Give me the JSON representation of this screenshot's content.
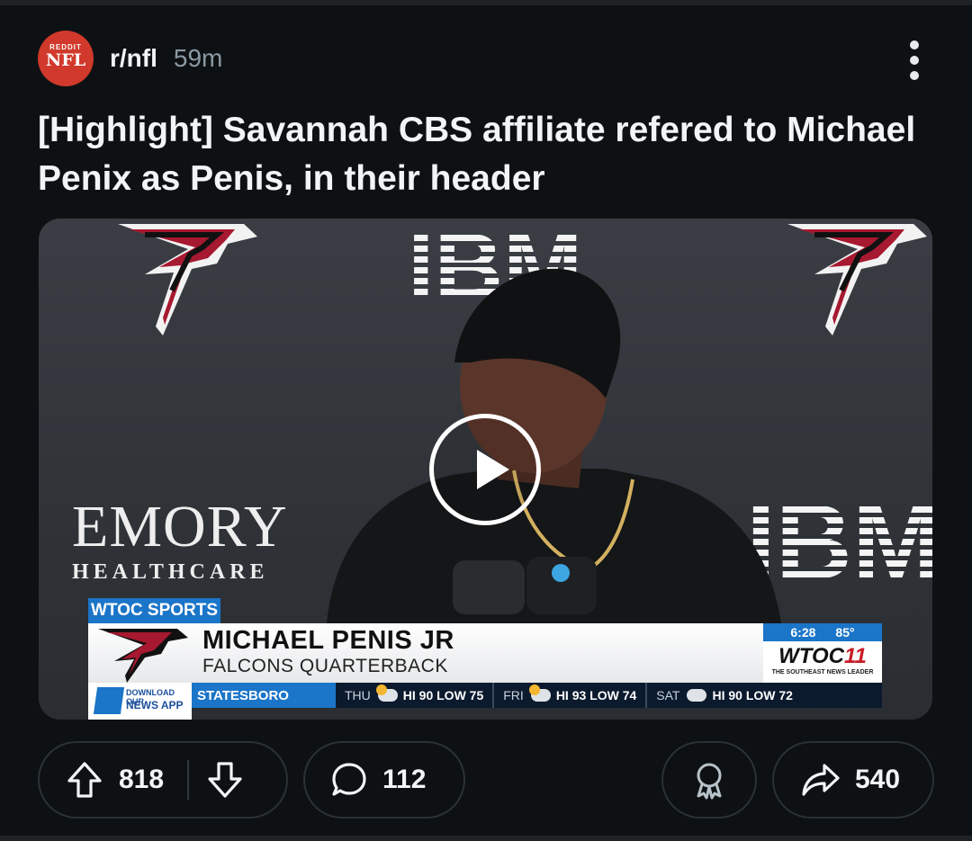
{
  "post": {
    "subreddit": "r/nfl",
    "age": "59m",
    "avatar_text_top": "REDDIT",
    "avatar_text_main": "NFL",
    "title": "[Highlight] Savannah CBS affiliate refered to Michael Penix as Penis, in their header"
  },
  "video": {
    "sponsor_left": "EMORY",
    "sponsor_left_sub": "HEALTHCARE",
    "sponsor_right": "IBM",
    "station_tag": "WTOC SPORTS",
    "lower_third_name": "MICHAEL PENIS JR",
    "lower_third_role": "FALCONS QUARTERBACK",
    "clock": "6:28",
    "temperature": "85°",
    "station_logo": "WTOC",
    "station_logo_num": "11",
    "station_slogan": "THE SOUTHEAST NEWS LEADER",
    "app_line1": "DOWNLOAD OUR",
    "app_line2": "NEWS APP",
    "ticker_city": "STATESBORO",
    "forecast": [
      {
        "day": "THU",
        "text": "HI 90 LOW 75"
      },
      {
        "day": "FRI",
        "text": "HI 93 LOW 74"
      },
      {
        "day": "SAT",
        "text": "HI 90 LOW 72"
      }
    ]
  },
  "actions": {
    "upvotes": "818",
    "comments": "112",
    "shares": "540"
  },
  "icons": {
    "avatar": "subreddit-avatar-icon",
    "more": "more-options-icon",
    "play": "play-icon",
    "upvote": "upvote-arrow-icon",
    "downvote": "downvote-arrow-icon",
    "comment": "comment-bubble-icon",
    "award": "award-icon",
    "share": "share-arrow-icon"
  },
  "colors": {
    "background": "#0e1113",
    "avatar": "#d0392b",
    "secondary_text": "#8a9aa4",
    "station_blue": "#1b75c8",
    "station_red": "#c81d25"
  }
}
